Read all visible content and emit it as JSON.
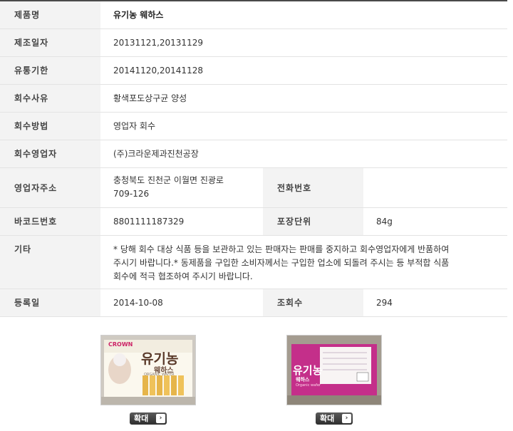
{
  "rows": {
    "product_name": {
      "label": "제품명",
      "value": "유기농 웨하스"
    },
    "manufacture_date": {
      "label": "제조일자",
      "value": "20131121,20131129"
    },
    "expiry_date": {
      "label": "유통기한",
      "value": "20141120,20141128"
    },
    "recall_reason": {
      "label": "회수사유",
      "value": "황색포도상구균 양성"
    },
    "recall_method": {
      "label": "회수방법",
      "value": "영업자 회수"
    },
    "recall_company": {
      "label": "회수영업자",
      "value": "(주)크라운제과진천공장"
    },
    "company_address": {
      "label": "영업자주소",
      "value_line1": "충청북도 진천군 이월면 진광로",
      "value_line2": "709-126"
    },
    "phone": {
      "label": "전화번호",
      "value": ""
    },
    "barcode": {
      "label": "바코드번호",
      "value": "8801111187329"
    },
    "package_unit": {
      "label": "포장단위",
      "value": "84g"
    },
    "etc": {
      "label": "기타",
      "value_line1": "* 당해 회수 대상 식품 등을 보관하고 있는 판매자는 판매를 중지하고 회수영업자에게 반품하여",
      "value_line2": "주시기 바랍니다.* 동제품을 구입한 소비자께서는 구입한 업소에 되돌려 주시는 등 부적합 식품",
      "value_line3": "회수에 적극 협조하여 주시기 바랍니다."
    },
    "registered": {
      "label": "등록일",
      "value": "2014-10-08"
    },
    "views": {
      "label": "조회수",
      "value": "294"
    }
  },
  "photos": {
    "left": {
      "brand_small": "CROWN",
      "title": "유기농",
      "subtitle": "웨하스",
      "caption": "ORGANIC WAFER"
    },
    "right": {
      "title": "유기농",
      "subtitle": "웨하스",
      "caption": "Organic wafer"
    },
    "enlarge_label": "확대",
    "arrow": "›"
  },
  "colors": {
    "label_bg": "#f3f3f3",
    "border": "#e3e3e3",
    "top_line": "#4a4a4a",
    "button_bg": "#3a3a3a"
  }
}
